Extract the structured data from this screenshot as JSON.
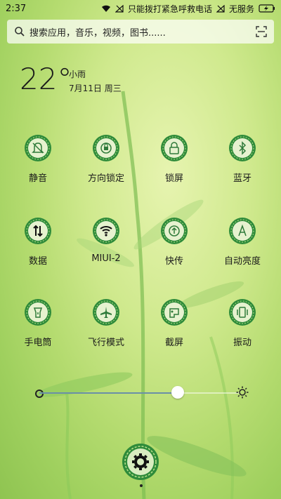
{
  "status": {
    "time": "2:37",
    "call_note": "只能拨打紧急呼救电话",
    "no_service": "无服务"
  },
  "search": {
    "placeholder": "搜索应用，音乐，视频，图书......"
  },
  "weather": {
    "temp": "22°",
    "condition": "小雨",
    "date": "7月11日 周三"
  },
  "tiles": [
    {
      "label": "静音",
      "icon": "bell-muted-icon"
    },
    {
      "label": "方向锁定",
      "icon": "rotation-lock-icon"
    },
    {
      "label": "锁屏",
      "icon": "lock-icon"
    },
    {
      "label": "蓝牙",
      "icon": "bluetooth-icon"
    },
    {
      "label": "数据",
      "icon": "data-transfer-icon"
    },
    {
      "label": "MIUI-2",
      "icon": "wifi-icon"
    },
    {
      "label": "快传",
      "icon": "fast-transfer-icon"
    },
    {
      "label": "自动亮度",
      "icon": "auto-brightness-icon"
    },
    {
      "label": "手电筒",
      "icon": "flashlight-icon"
    },
    {
      "label": "飞行模式",
      "icon": "airplane-icon"
    },
    {
      "label": "截屏",
      "icon": "screenshot-icon"
    },
    {
      "label": "振动",
      "icon": "vibrate-icon"
    }
  ],
  "brightness": {
    "level": 0.66
  },
  "colors": {
    "badge_ring": "#2e8b3a",
    "badge_fill": "#e6f2cf",
    "icon_color": "#2f7a3a"
  }
}
